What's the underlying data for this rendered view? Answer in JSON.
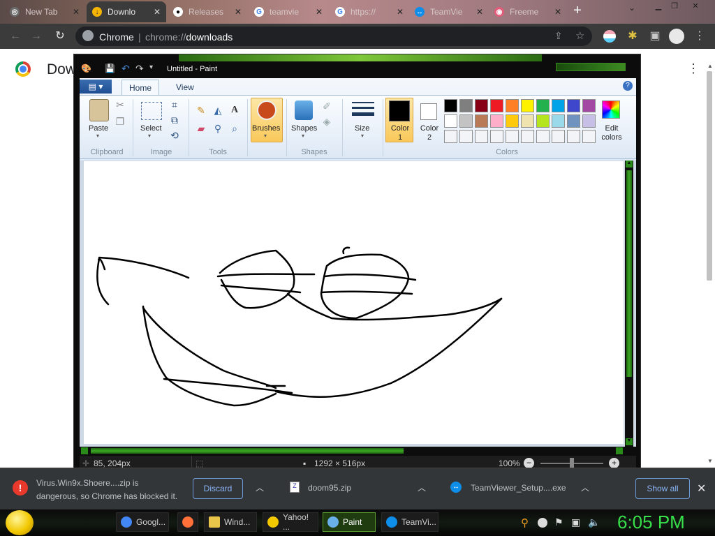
{
  "browser": {
    "tabs": [
      {
        "title": "New Tab",
        "active": false
      },
      {
        "title": "Downlo",
        "active": true
      },
      {
        "title": "Releases",
        "active": false
      },
      {
        "title": "teamvie",
        "active": false
      },
      {
        "title": "https://",
        "active": false
      },
      {
        "title": "TeamVie",
        "active": false
      },
      {
        "title": "Freeme",
        "active": false
      }
    ],
    "omnibox": {
      "label": "Chrome",
      "separator": "|",
      "url_scheme": "chrome://",
      "url_host": "downloads"
    }
  },
  "page": {
    "title": "Dow"
  },
  "paint": {
    "title": "Untitled - Paint",
    "menu_tabs": [
      "Home",
      "View"
    ],
    "groups": {
      "clipboard": "Clipboard",
      "image": "Image",
      "tools": "Tools",
      "shapes": "Shapes",
      "colors": "Colors"
    },
    "buttons": {
      "paste": "Paste",
      "select": "Select",
      "brushes": "Brushes",
      "shapes": "Shapes",
      "size": "Size",
      "color1": "Color 1",
      "color2": "Color 2",
      "edit_colors": "Edit colors"
    },
    "palette_row1": [
      "#000000",
      "#7f7f7f",
      "#880015",
      "#ed1c24",
      "#ff7f27",
      "#fff200",
      "#22b14c",
      "#00a2e8",
      "#3f48cc",
      "#a349a4"
    ],
    "palette_row2": [
      "#ffffff",
      "#c3c3c3",
      "#b97a57",
      "#ffaec9",
      "#ffc90e",
      "#efe4b0",
      "#b5e61d",
      "#99d9ea",
      "#7092be",
      "#c8bfe7"
    ],
    "color1": "#000000",
    "color2": "#ffffff",
    "status": {
      "cursor": "85, 204px",
      "dimensions": "1292 × 516px",
      "zoom": "100%"
    }
  },
  "downloads": {
    "warning_line1": "Virus.Win9x.Shoere....zip is",
    "warning_line2": "dangerous, so Chrome has blocked it.",
    "discard": "Discard",
    "item2": "doom95.zip",
    "item3": "TeamViewer_Setup....exe",
    "show_all": "Show all"
  },
  "taskbar": {
    "items": [
      {
        "label": "Googl...",
        "color": "#4285f4"
      },
      {
        "label": "",
        "color": "#ff7139"
      },
      {
        "label": "Wind...",
        "color": "#e9c54a"
      },
      {
        "label": "Yahoo! ...",
        "color": "#f2c800"
      },
      {
        "label": "Paint",
        "color": "#6ab0e8"
      },
      {
        "label": "TeamVi...",
        "color": "#0e8ee9"
      }
    ],
    "clock": "6:05 PM"
  }
}
